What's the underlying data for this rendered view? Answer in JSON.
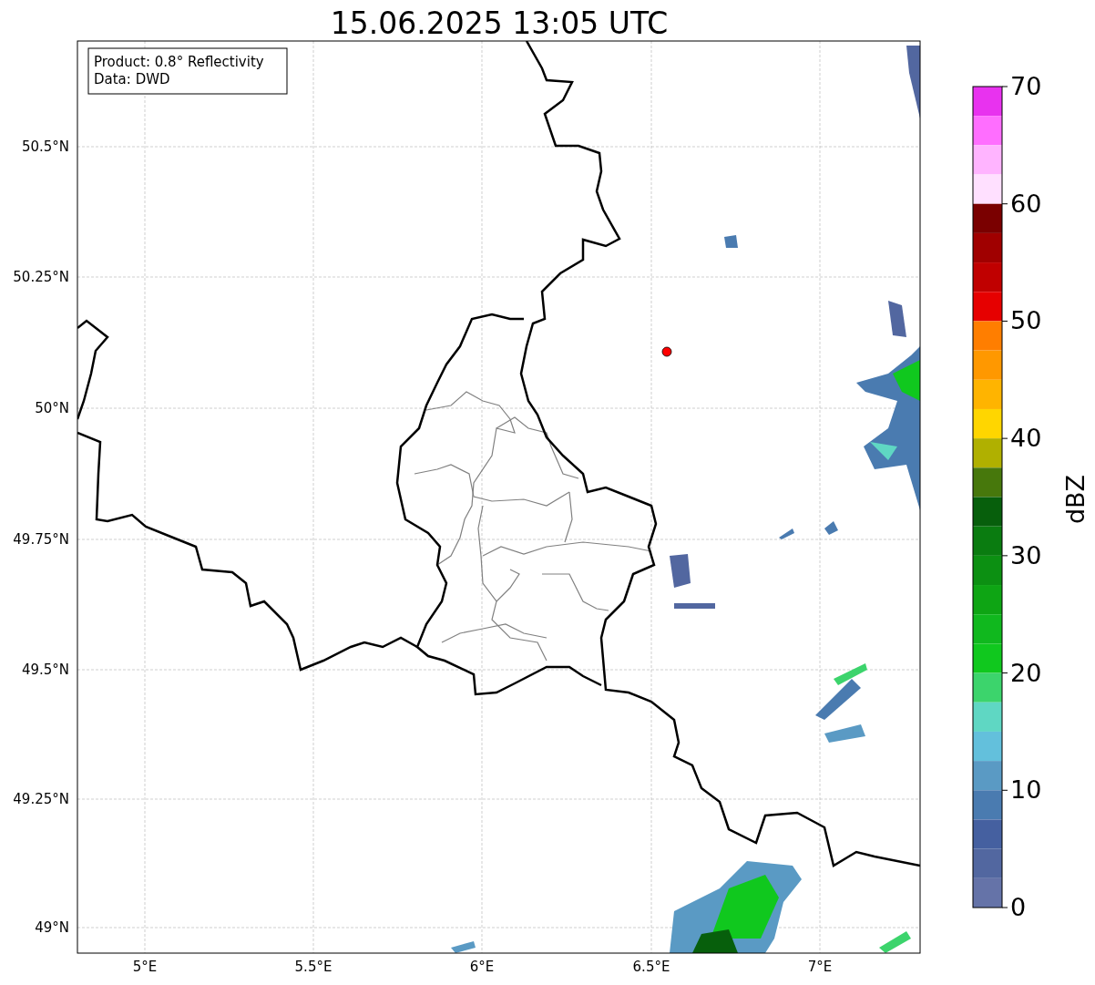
{
  "title": "15.06.2025 13:05 UTC",
  "legend": [
    "Product: 0.8° Reflectivity",
    "Data: DWD"
  ],
  "lat_ticks": [
    "50.5°N",
    "50.25°N",
    "50°N",
    "49.75°N",
    "49.5°N",
    "49.25°N",
    "49°N"
  ],
  "lon_ticks": [
    "5°E",
    "5.5°E",
    "6°E",
    "6.5°E",
    "7°E"
  ],
  "colorbar": {
    "label": "dBZ",
    "ticks": [
      "70",
      "60",
      "50",
      "40",
      "30",
      "20",
      "10",
      "0"
    ],
    "bins": [
      {
        "color": "#e832ef"
      },
      {
        "color": "#ff6eff"
      },
      {
        "color": "#ffb4ff"
      },
      {
        "color": "#ffe0ff"
      },
      {
        "color": "#7a0000"
      },
      {
        "color": "#a00000"
      },
      {
        "color": "#c00000"
      },
      {
        "color": "#e60000"
      },
      {
        "color": "#ff7e00"
      },
      {
        "color": "#ff9800"
      },
      {
        "color": "#ffb400"
      },
      {
        "color": "#ffd600"
      },
      {
        "color": "#b0b000"
      },
      {
        "color": "#47780c"
      },
      {
        "color": "#075f0c"
      },
      {
        "color": "#0a7c10"
      },
      {
        "color": "#0c9012"
      },
      {
        "color": "#0ea514"
      },
      {
        "color": "#10b81e"
      },
      {
        "color": "#10c81e"
      },
      {
        "color": "#3cd46c"
      },
      {
        "color": "#5fd7c3"
      },
      {
        "color": "#63c0dc"
      },
      {
        "color": "#5a9ac4"
      },
      {
        "color": "#4a7bb0"
      },
      {
        "color": "#4560a0"
      },
      {
        "color": "#5267a0"
      },
      {
        "color": "#6573a8"
      }
    ]
  }
}
